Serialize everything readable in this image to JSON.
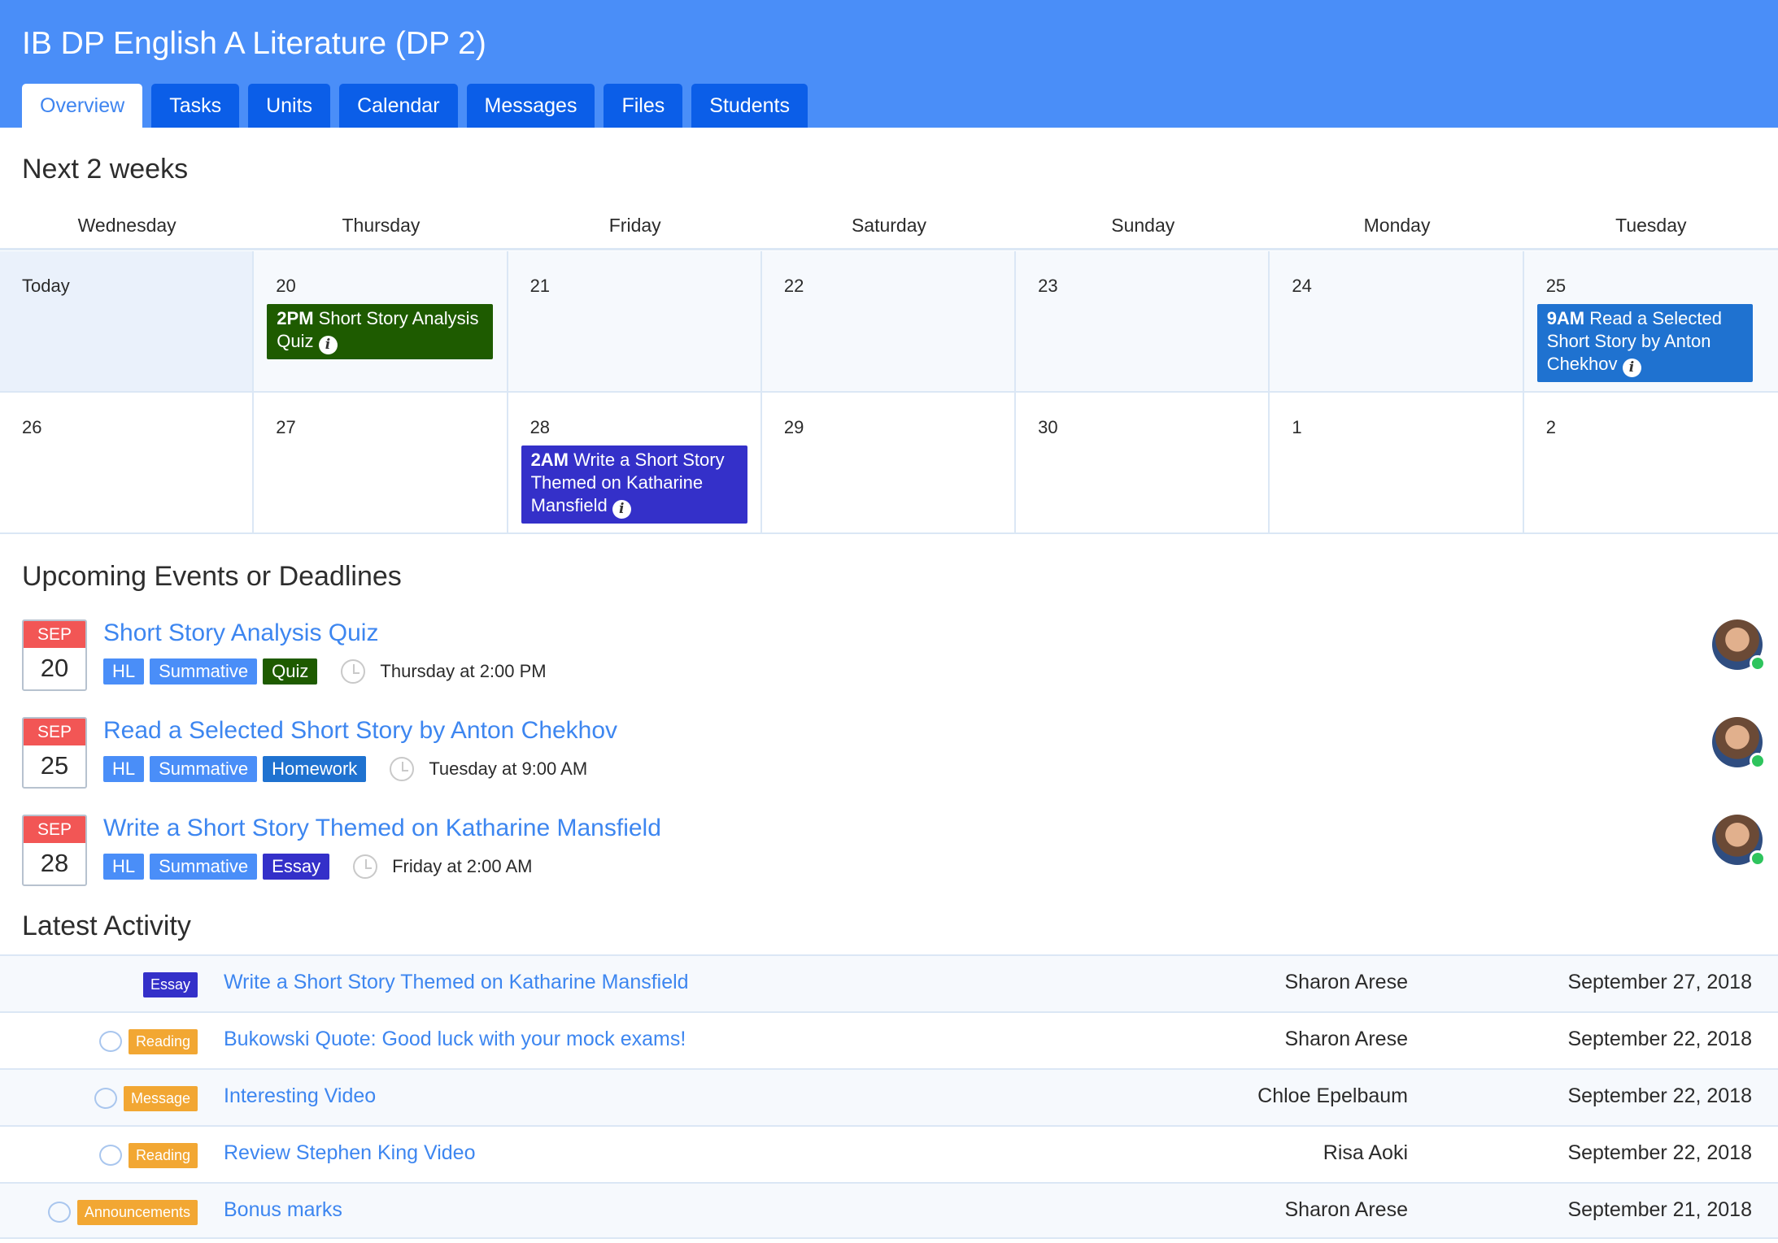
{
  "course_title": "IB DP English A Literature (DP 2)",
  "tabs": [
    "Overview",
    "Tasks",
    "Units",
    "Calendar",
    "Messages",
    "Files",
    "Students"
  ],
  "active_tab": "Overview",
  "next_weeks": {
    "heading": "Next 2 weeks",
    "weekdays": [
      "Wednesday",
      "Thursday",
      "Friday",
      "Saturday",
      "Sunday",
      "Monday",
      "Tuesday"
    ],
    "rows": [
      [
        "Today",
        "20",
        "21",
        "22",
        "23",
        "24",
        "25"
      ],
      [
        "26",
        "27",
        "28",
        "29",
        "30",
        "1",
        "2"
      ]
    ],
    "events": [
      {
        "time": "2PM",
        "title": "Short Story Analysis Quiz",
        "color": "#1e5b00"
      },
      {
        "time": "9AM",
        "title": "Read a Selected Short Story by Anton Chekhov",
        "color": "#1f72d0"
      },
      {
        "time": "2AM",
        "title": "Write a Short Story Themed on Katharine Mansfield",
        "color": "#3430c9"
      }
    ]
  },
  "upcoming": {
    "heading": "Upcoming Events or Deadlines",
    "items": [
      {
        "month": "SEP",
        "day": "20",
        "title": "Short Story Analysis Quiz",
        "tags": [
          "HL",
          "Summative",
          "Quiz"
        ],
        "type_color": "#1e5b00",
        "time": "Thursday at 2:00 PM"
      },
      {
        "month": "SEP",
        "day": "25",
        "title": "Read a Selected Short Story by Anton Chekhov",
        "tags": [
          "HL",
          "Summative",
          "Homework"
        ],
        "type_color": "#1f72d0",
        "time": "Tuesday at 9:00 AM"
      },
      {
        "month": "SEP",
        "day": "28",
        "title": "Write a Short Story Themed on Katharine Mansfield",
        "tags": [
          "HL",
          "Summative",
          "Essay"
        ],
        "type_color": "#3430c9",
        "time": "Friday at 2:00 AM"
      }
    ]
  },
  "activity": {
    "heading": "Latest Activity",
    "items": [
      {
        "badge": "Essay",
        "badge_color": "#3430c9",
        "has_comment": false,
        "title": "Write a Short Story Themed on Katharine Mansfield",
        "author": "Sharon Arese",
        "date": "September 27, 2018"
      },
      {
        "badge": "Reading",
        "badge_color": "#f2a733",
        "has_comment": true,
        "title": "Bukowski Quote: Good luck with your mock exams!",
        "author": "Sharon Arese",
        "date": "September 22, 2018"
      },
      {
        "badge": "Message",
        "badge_color": "#f2a733",
        "has_comment": true,
        "title": "Interesting Video",
        "author": "Chloe Epelbaum",
        "date": "September 22, 2018"
      },
      {
        "badge": "Reading",
        "badge_color": "#f2a733",
        "has_comment": true,
        "title": "Review Stephen King Video",
        "author": "Risa Aoki",
        "date": "September 22, 2018"
      },
      {
        "badge": "Announcements",
        "badge_color": "#f2a733",
        "has_comment": true,
        "title": "Bonus marks",
        "author": "Sharon Arese",
        "date": "September 21, 2018"
      }
    ]
  }
}
